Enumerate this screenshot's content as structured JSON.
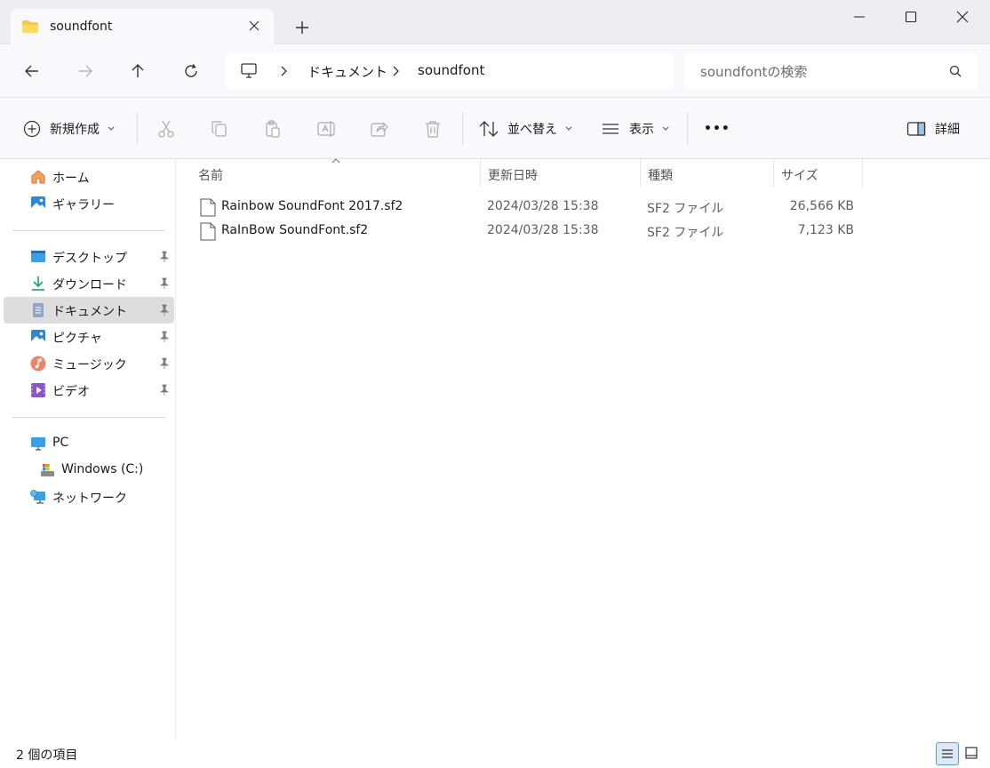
{
  "window": {
    "tab_title": "soundfont",
    "new_tab_symbol": "+"
  },
  "address": {
    "crumbs": [
      "ドキュメント",
      "soundfont"
    ]
  },
  "search": {
    "placeholder": "soundfontの検索"
  },
  "toolbar": {
    "new_label": "新規作成",
    "sort_label": "並べ替え",
    "view_label": "表示",
    "more_label": "•••",
    "details_label": "詳細"
  },
  "sidebar": {
    "home": "ホーム",
    "gallery": "ギャラリー",
    "quick": [
      {
        "label": "デスクトップ",
        "icon": "desktop-icon"
      },
      {
        "label": "ダウンロード",
        "icon": "download-icon"
      },
      {
        "label": "ドキュメント",
        "icon": "documents-icon"
      },
      {
        "label": "ピクチャ",
        "icon": "pictures-icon"
      },
      {
        "label": "ミュージック",
        "icon": "music-icon"
      },
      {
        "label": "ビデオ",
        "icon": "video-icon"
      }
    ],
    "pc": "PC",
    "drive": "Windows (C:)",
    "network": "ネットワーク"
  },
  "columns": {
    "name": "名前",
    "date": "更新日時",
    "type": "種類",
    "size": "サイズ"
  },
  "files": [
    {
      "name": "Rainbow SoundFont 2017.sf2",
      "date": "2024/03/28 15:38",
      "type": "SF2 ファイル",
      "size": "26,566 KB"
    },
    {
      "name": "RaInBow SoundFont.sf2",
      "date": "2024/03/28 15:38",
      "type": "SF2 ファイル",
      "size": "7,123 KB"
    }
  ],
  "status": {
    "count": "2 個の項目"
  },
  "colors": {
    "accent": "#0067c0",
    "selected_row": "#dddddd",
    "chrome": "#f9f9fb",
    "titlebar": "#ededf2"
  }
}
